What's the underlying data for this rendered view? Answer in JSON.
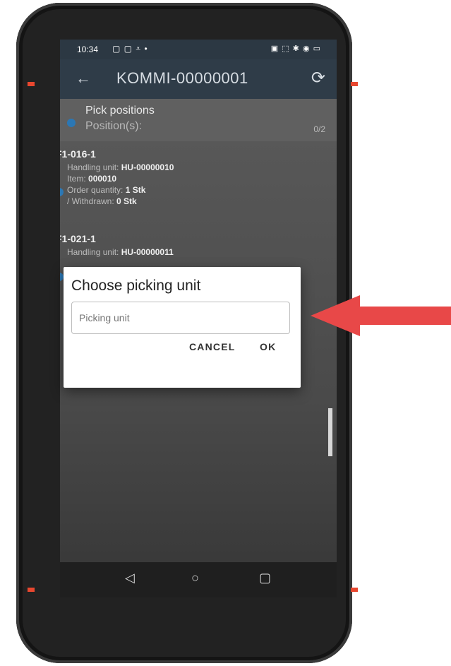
{
  "status_bar": {
    "time": "10:34",
    "left_icons": "▢ ▢ ⩡ •",
    "right_icons": "▣ ⬚ ✱ ◉ ▭"
  },
  "app_bar": {
    "back_icon": "←",
    "title": "KOMMI-00000001",
    "sync_icon": "⟳"
  },
  "pick_header": {
    "title": "Pick positions",
    "subtitle": "Position(s):",
    "count": "0/2"
  },
  "positions": [
    {
      "location": "F1-016-1",
      "handling_unit_label": "Handling unit:",
      "handling_unit": "HU-00000010",
      "item_label": "Item:",
      "item": "000010",
      "order_quantity_label": "Order quantity:",
      "order_quantity": "1 Stk",
      "withdrawn_label": "/ Withdrawn:",
      "withdrawn": "0 Stk"
    },
    {
      "location": "F1-021-1",
      "handling_unit_label": "Handling unit:",
      "handling_unit": "HU-00000011"
    }
  ],
  "dialog": {
    "title": "Choose picking unit",
    "input_placeholder": "Picking unit",
    "input_value": "",
    "cancel_label": "CANCEL",
    "ok_label": "OK"
  },
  "nav_bar": {
    "back": "◁",
    "home": "○",
    "recents": "▢"
  },
  "colors": {
    "app_bar": "#2f3c48",
    "status_dot": "#2b77b4",
    "arrow": "#e84848",
    "device_accent": "#e8472f"
  }
}
